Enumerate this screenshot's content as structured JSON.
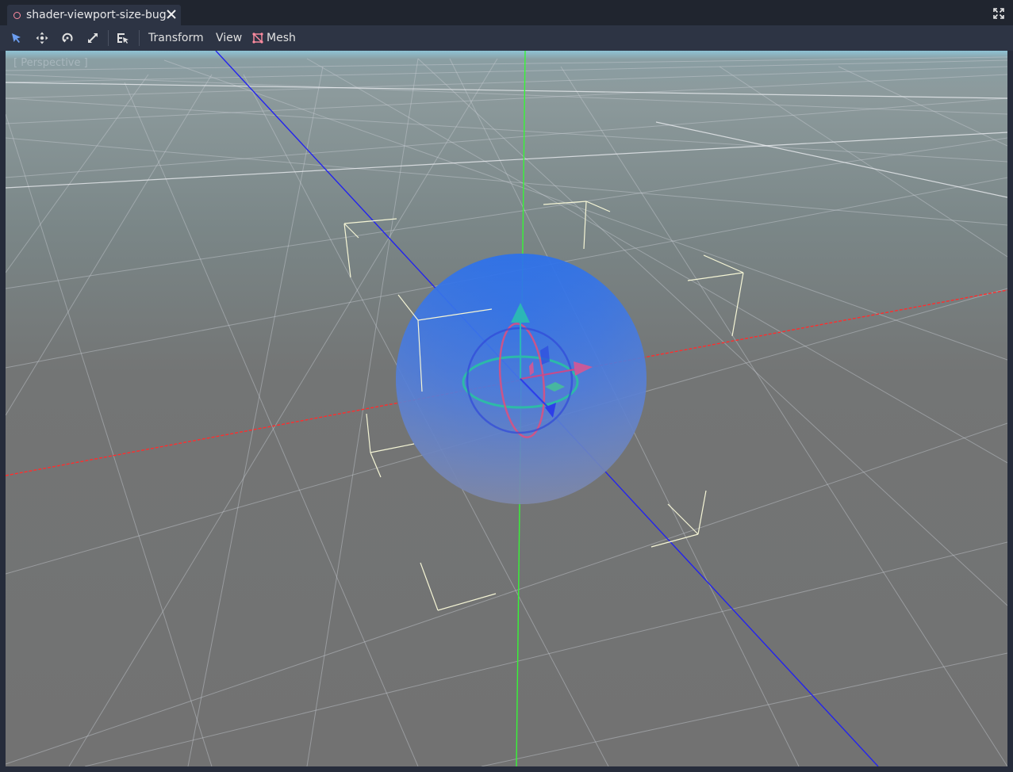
{
  "tab": {
    "title": "shader-viewport-size-bug"
  },
  "toolbar": {
    "menus": {
      "transform": "Transform",
      "view": "View",
      "mesh": "Mesh"
    }
  },
  "viewport": {
    "label": "[ Perspective ]"
  },
  "colors": {
    "x_axis": "#ff3b3b",
    "y_axis": "#3cff3c",
    "z_axis": "#2b2bff",
    "sky": "#8fc3d5",
    "ground": "#737373",
    "sphere": "#2a6be8"
  },
  "icons": [
    "scene-circle-icon",
    "close-icon",
    "fullscreen-icon",
    "select-tool-icon",
    "move-tool-icon",
    "rotate-tool-icon",
    "scale-tool-icon",
    "list-select-icon",
    "mesh-icon"
  ]
}
